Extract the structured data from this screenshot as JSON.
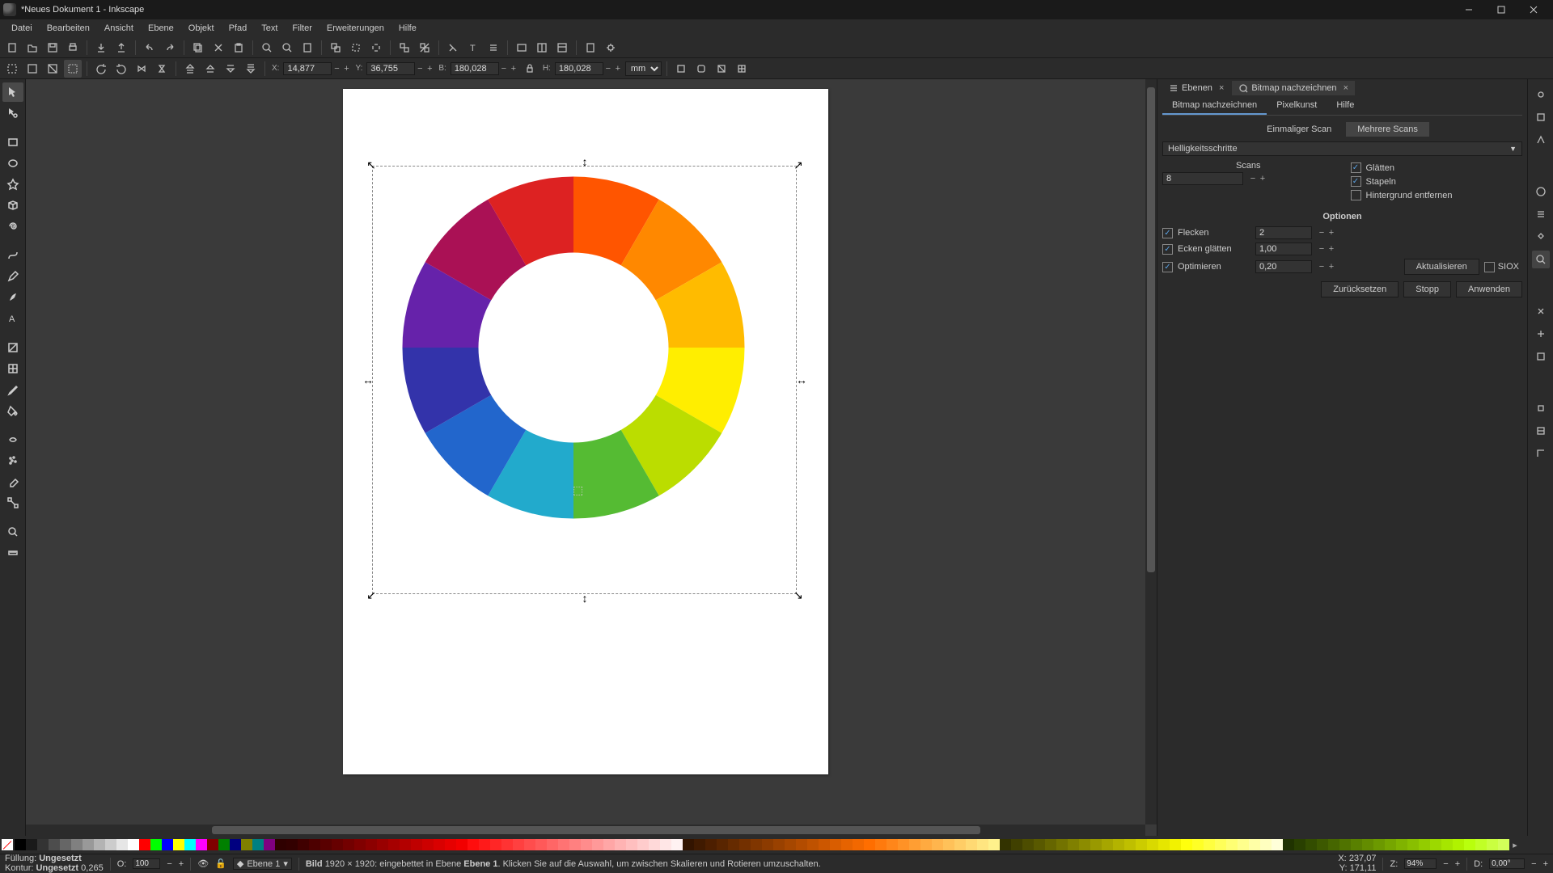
{
  "window": {
    "title": "*Neues Dokument 1 - Inkscape"
  },
  "menu": {
    "file": "Datei",
    "edit": "Bearbeiten",
    "view": "Ansicht",
    "layer": "Ebene",
    "object": "Objekt",
    "path": "Pfad",
    "text": "Text",
    "filters": "Filter",
    "extensions": "Erweiterungen",
    "help": "Hilfe"
  },
  "coords": {
    "x_label": "X:",
    "x": "14,877",
    "y_label": "Y:",
    "y": "36,755",
    "w_label": "B:",
    "w": "180,028",
    "h_label": "H:",
    "h": "180,028",
    "unit": "mm"
  },
  "dock": {
    "tab_layers": "Ebenen",
    "tab_trace": "Bitmap nachzeichnen",
    "sub_trace": "Bitmap nachzeichnen",
    "sub_pixel": "Pixelkunst",
    "sub_help": "Hilfe",
    "mode_single": "Einmaliger Scan",
    "mode_multi": "Mehrere Scans",
    "method": "Helligkeitsschritte",
    "scans_label": "Scans",
    "scans_value": "8",
    "smooth": "Glätten",
    "stack": "Stapeln",
    "remove_bg": "Hintergrund entfernen",
    "options_hdr": "Optionen",
    "speckles": "Flecken",
    "speckles_val": "2",
    "corners": "Ecken glätten",
    "corners_val": "1,00",
    "optimize": "Optimieren",
    "optimize_val": "0,20",
    "update": "Aktualisieren",
    "siox": "SIOX",
    "reset": "Zurücksetzen",
    "stop": "Stopp",
    "apply": "Anwenden"
  },
  "status": {
    "fill_label": "Füllung:",
    "fill_value": "Ungesetzt",
    "stroke_label": "Kontur:",
    "stroke_value": "Ungesetzt",
    "stroke_w": "0,265",
    "opacity_label": "O:",
    "opacity": "100",
    "layer_prefix": "Ebene 1",
    "info_type": "Bild",
    "info_dims": "1920 × 1920: eingebettet in Ebene ",
    "info_layer_bold": "Ebene 1",
    "info_rest": ". Klicken Sie auf die Auswahl, um zwischen Skalieren und Rotieren umzuschalten.",
    "ptr_x_label": "X:",
    "ptr_x": "237,07",
    "ptr_y_label": "Y:",
    "ptr_y": "171,11",
    "zoom_label": "Z:",
    "zoom": "94%",
    "rot_label": "D:",
    "rot": "0,00°"
  },
  "palette": [
    "#000000",
    "#1a1a1a",
    "#333333",
    "#4d4d4d",
    "#666666",
    "#808080",
    "#999999",
    "#b3b3b3",
    "#cccccc",
    "#e6e6e6",
    "#ffffff",
    "#ff0000",
    "#00ff00",
    "#0000ff",
    "#ffff00",
    "#00ffff",
    "#ff00ff",
    "#800000",
    "#008000",
    "#000080",
    "#808000",
    "#008080",
    "#800080",
    "#2f0000",
    "#330000",
    "#400000",
    "#4d0000",
    "#590000",
    "#660000",
    "#730000",
    "#800000",
    "#8c0000",
    "#990000",
    "#a60000",
    "#b30000",
    "#bf0000",
    "#cc0000",
    "#d90000",
    "#e60000",
    "#f20000",
    "#ff0d0d",
    "#ff1a1a",
    "#ff2626",
    "#ff3333",
    "#ff4040",
    "#ff4d4d",
    "#ff5959",
    "#ff6666",
    "#ff7373",
    "#ff8080",
    "#ff8c8c",
    "#ff9999",
    "#ffa6a6",
    "#ffb3b3",
    "#ffbfbf",
    "#ffcccc",
    "#ffd9d9",
    "#ffe6e6",
    "#fff2f2",
    "#331400",
    "#401a00",
    "#4d1f00",
    "#592500",
    "#662b00",
    "#733000",
    "#803600",
    "#8c3b00",
    "#994100",
    "#a64700",
    "#b34c00",
    "#bf5200",
    "#cc5700",
    "#d95d00",
    "#e66300",
    "#f26800",
    "#ff6e00",
    "#ff7a0d",
    "#ff861a",
    "#ff9226",
    "#ff9e33",
    "#ffaa40",
    "#ffb54d",
    "#ffc159",
    "#ffcd66",
    "#ffd973",
    "#ffe580",
    "#fff18c",
    "#333300",
    "#404000",
    "#4d4d00",
    "#595900",
    "#666600",
    "#737300",
    "#808000",
    "#8c8c00",
    "#999900",
    "#a6a600",
    "#b3b300",
    "#bfbf00",
    "#cccc00",
    "#d9d900",
    "#e6e600",
    "#f2f200",
    "#ffff0d",
    "#ffff26",
    "#ffff40",
    "#ffff59",
    "#ffff73",
    "#ffff8c",
    "#ffffa6",
    "#ffffbf",
    "#ffffd9",
    "#203300",
    "#294000",
    "#334d00",
    "#3d5900",
    "#466600",
    "#507300",
    "#598000",
    "#638c00",
    "#6c9900",
    "#76a600",
    "#80b300",
    "#89bf00",
    "#93cc00",
    "#9cd900",
    "#a6e600",
    "#b0f200",
    "#b9ff0d",
    "#c1ff26",
    "#caff40",
    "#d2ff59"
  ],
  "chart_data": null
}
